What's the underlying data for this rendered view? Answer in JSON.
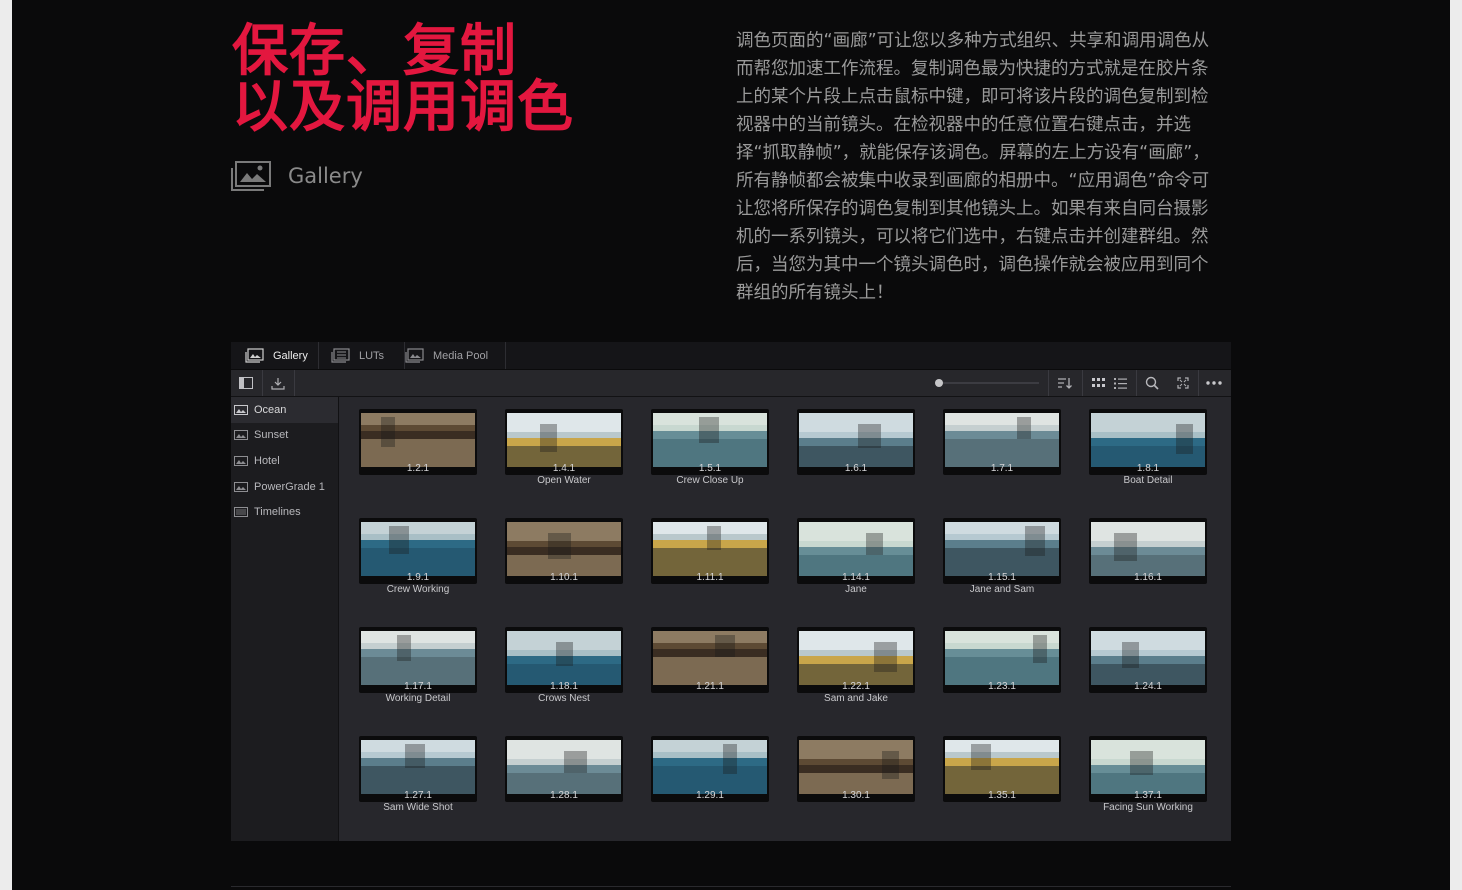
{
  "header": {
    "title_line1": "保存、复制",
    "title_line2": "以及调用调色",
    "section_label": "Gallery",
    "description": "调色页面的“画廊”可让您以多种方式组织、共享和调用调色从而帮您加速工作流程。复制调色最为快捷的方式就是在胶片条上的某个片段上点击鼠标中键，即可将该片段的调色复制到检视器中的当前镜头。在检视器中的任意位置右键点击，并选择“抓取静帧”，就能保存该调色。屏幕的左上方设有“画廊”，所有静帧都会被集中收录到画廊的相册中。“应用调色”命令可让您将所保存的调色复制到其他镜头上。如果有来自同台摄影机的一系列镜头，可以将它们选中，右键点击并创建群组。然后，当您为其中一个镜头调色时，调色操作就会被应用到同个群组的所有镜头上！",
    "accent_color": "#e3173f"
  },
  "app": {
    "tabs": [
      {
        "label": "Gallery",
        "icon": "gallery-icon",
        "active": true
      },
      {
        "label": "LUTs",
        "icon": "luts-icon",
        "active": false
      },
      {
        "label": "Media Pool",
        "icon": "media-pool-icon",
        "active": false
      }
    ],
    "toolbar": {
      "left_buttons": [
        "sidebar-toggle-icon",
        "download-icon"
      ],
      "zoom_slider_value": 0.0,
      "right_buttons": [
        "sort-icon",
        "grid-view-icon",
        "list-view-icon",
        "search-icon",
        "expand-icon",
        "more-icon"
      ]
    },
    "sidebar": {
      "items": [
        {
          "label": "Ocean",
          "icon": "album-icon",
          "active": true
        },
        {
          "label": "Sunset",
          "icon": "album-icon",
          "active": false
        },
        {
          "label": "Hotel",
          "icon": "album-icon",
          "active": false
        },
        {
          "label": "PowerGrade 1",
          "icon": "album-icon",
          "active": false
        },
        {
          "label": "Timelines",
          "icon": "timeline-album-icon",
          "active": false
        }
      ]
    },
    "stills": [
      {
        "num": "1.2.1",
        "name": ""
      },
      {
        "num": "1.4.1",
        "name": "Open Water"
      },
      {
        "num": "1.5.1",
        "name": "Crew Close Up"
      },
      {
        "num": "1.6.1",
        "name": ""
      },
      {
        "num": "1.7.1",
        "name": ""
      },
      {
        "num": "1.8.1",
        "name": "Boat Detail"
      },
      {
        "num": "1.9.1",
        "name": "Crew Working"
      },
      {
        "num": "1.10.1",
        "name": ""
      },
      {
        "num": "1.11.1",
        "name": ""
      },
      {
        "num": "1.14.1",
        "name": "Jane"
      },
      {
        "num": "1.15.1",
        "name": "Jane and Sam"
      },
      {
        "num": "1.16.1",
        "name": ""
      },
      {
        "num": "1.17.1",
        "name": "Working Detail"
      },
      {
        "num": "1.18.1",
        "name": "Crows Nest"
      },
      {
        "num": "1.21.1",
        "name": ""
      },
      {
        "num": "1.22.1",
        "name": "Sam and Jake"
      },
      {
        "num": "1.23.1",
        "name": ""
      },
      {
        "num": "1.24.1",
        "name": ""
      },
      {
        "num": "1.27.1",
        "name": "Sam Wide Shot"
      },
      {
        "num": "1.28.1",
        "name": ""
      },
      {
        "num": "1.29.1",
        "name": ""
      },
      {
        "num": "1.30.1",
        "name": ""
      },
      {
        "num": "1.35.1",
        "name": ""
      },
      {
        "num": "1.37.1",
        "name": "Facing Sun Working"
      }
    ]
  }
}
